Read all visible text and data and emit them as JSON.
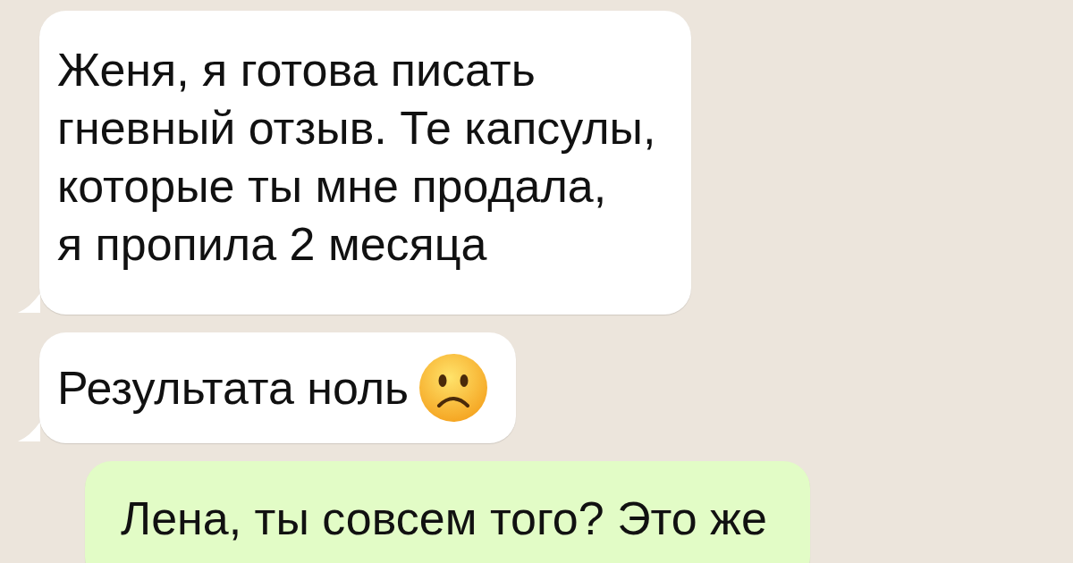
{
  "messages": [
    {
      "kind": "incoming",
      "text": "Женя, я готова писать\nгневный отзыв. Те капсулы,\nкоторые ты мне продала,\nя пропила 2 месяца",
      "has_emoji": false
    },
    {
      "kind": "incoming",
      "text": "Результата ноль",
      "has_emoji": true
    },
    {
      "kind": "outgoing",
      "text": "Лена, ты совсем того? Это же",
      "has_emoji": false
    }
  ]
}
